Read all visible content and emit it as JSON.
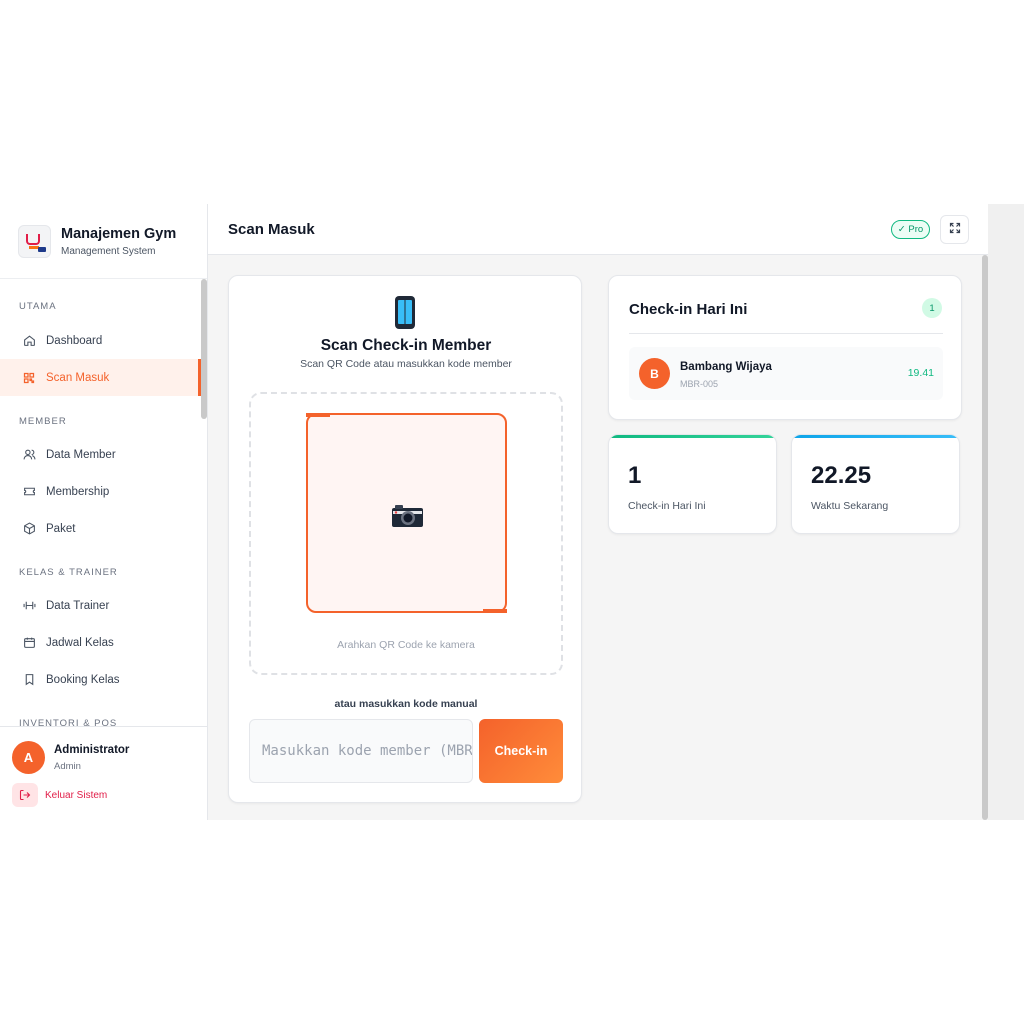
{
  "brand": {
    "title": "Manajemen Gym",
    "subtitle": "Management System"
  },
  "sidebar": {
    "sections": [
      {
        "label": "UTAMA",
        "items": [
          {
            "label": "Dashboard",
            "icon": "home-icon"
          },
          {
            "label": "Scan Masuk",
            "icon": "qr-icon",
            "active": true
          }
        ]
      },
      {
        "label": "MEMBER",
        "items": [
          {
            "label": "Data Member",
            "icon": "users-icon"
          },
          {
            "label": "Membership",
            "icon": "ticket-icon"
          },
          {
            "label": "Paket",
            "icon": "box-icon"
          }
        ]
      },
      {
        "label": "KELAS & TRAINER",
        "items": [
          {
            "label": "Data Trainer",
            "icon": "dumbbell-icon"
          },
          {
            "label": "Jadwal Kelas",
            "icon": "calendar-icon"
          },
          {
            "label": "Booking Kelas",
            "icon": "bookmark-icon"
          }
        ]
      },
      {
        "label": "INVENTORI & POS"
      }
    ]
  },
  "user": {
    "initial": "A",
    "name": "Administrator",
    "role": "Admin",
    "logout_label": "Keluar Sistem"
  },
  "header": {
    "title": "Scan Masuk",
    "badge": "✓ Pro"
  },
  "scan": {
    "title": "Scan Check-in Member",
    "subtitle": "Scan QR Code atau masukkan kode member",
    "camera_hint": "Arahkan QR Code ke kamera",
    "manual_label": "atau masukkan kode manual",
    "input_placeholder": "Masukkan kode member (MBR-xxx)",
    "input_value": "",
    "button_label": "Check-in"
  },
  "today": {
    "title": "Check-in Hari Ini",
    "count": "1",
    "items": [
      {
        "initial": "B",
        "name": "Bambang Wijaya",
        "id": "MBR-005",
        "time": "19.41"
      }
    ]
  },
  "stats": [
    {
      "value": "1",
      "label": "Check-in Hari Ini",
      "color": "#10b981"
    },
    {
      "value": "22.25",
      "label": "Waktu Sekarang",
      "color": "#0ea5e9"
    }
  ],
  "colors": {
    "accent": "#f4622b",
    "success": "#10b981",
    "info": "#0ea5e9"
  }
}
